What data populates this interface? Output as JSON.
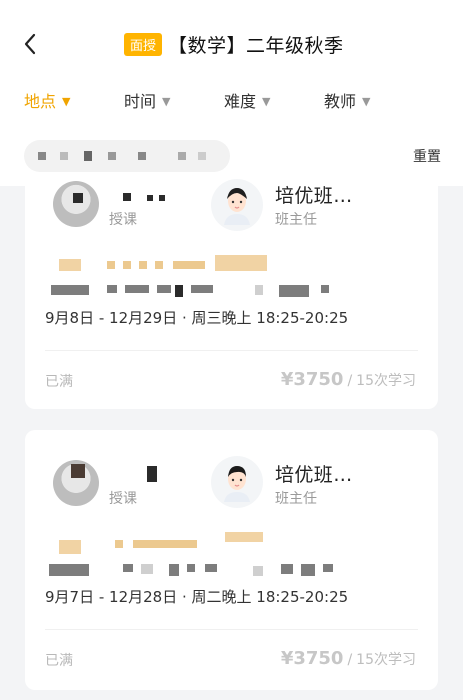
{
  "header": {
    "badge": "面授",
    "title": "【数学】二年级秋季"
  },
  "filters": [
    {
      "label": "地点",
      "active": true
    },
    {
      "label": "时间",
      "active": false
    },
    {
      "label": "难度",
      "active": false
    },
    {
      "label": "教师",
      "active": false
    }
  ],
  "subbar": {
    "reset_label": "重置"
  },
  "cards": [
    {
      "teacher_role_left": "授课",
      "teacher_name": "培优班…",
      "teacher_role_right": "班主任",
      "date_range": "9月8日 - 12月29日 · 周三晚上 18:25-20:25",
      "status": "已满",
      "price": "¥3750",
      "sessions": "15次学习"
    },
    {
      "teacher_role_left": "授课",
      "teacher_name": "培优班…",
      "teacher_role_right": "班主任",
      "date_range": "9月7日 - 12月28日 · 周二晚上 18:25-20:25",
      "status": "已满",
      "price": "¥3750",
      "sessions": "15次学习"
    }
  ]
}
